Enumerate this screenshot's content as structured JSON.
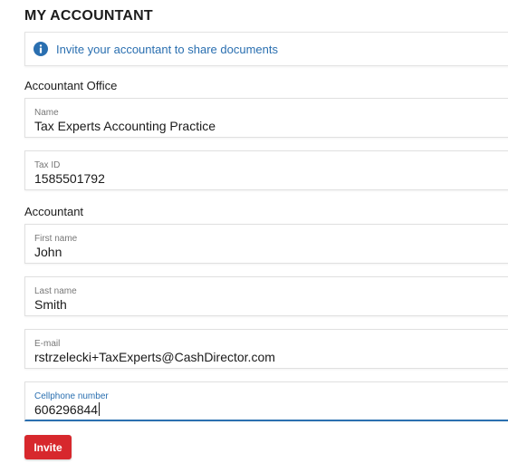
{
  "page_title": "MY ACCOUNTANT",
  "info": {
    "icon": "info-icon",
    "text": "Invite your accountant to share documents",
    "color": "#2a6fb0"
  },
  "sections": {
    "office_label": "Accountant Office",
    "accountant_label": "Accountant"
  },
  "fields": {
    "name": {
      "label": "Name",
      "value": "Tax Experts Accounting Practice"
    },
    "tax_id": {
      "label": "Tax ID",
      "value": "1585501792"
    },
    "first_name": {
      "label": "First name",
      "value": "John"
    },
    "last_name": {
      "label": "Last name",
      "value": "Smith"
    },
    "email": {
      "label": "E-mail",
      "value": "rstrzelecki+TaxExperts@CashDirector.com"
    },
    "cellphone": {
      "label": "Cellphone number",
      "value": "606296844"
    }
  },
  "invite_button": {
    "label": "Invite",
    "color": "#d7282d"
  }
}
